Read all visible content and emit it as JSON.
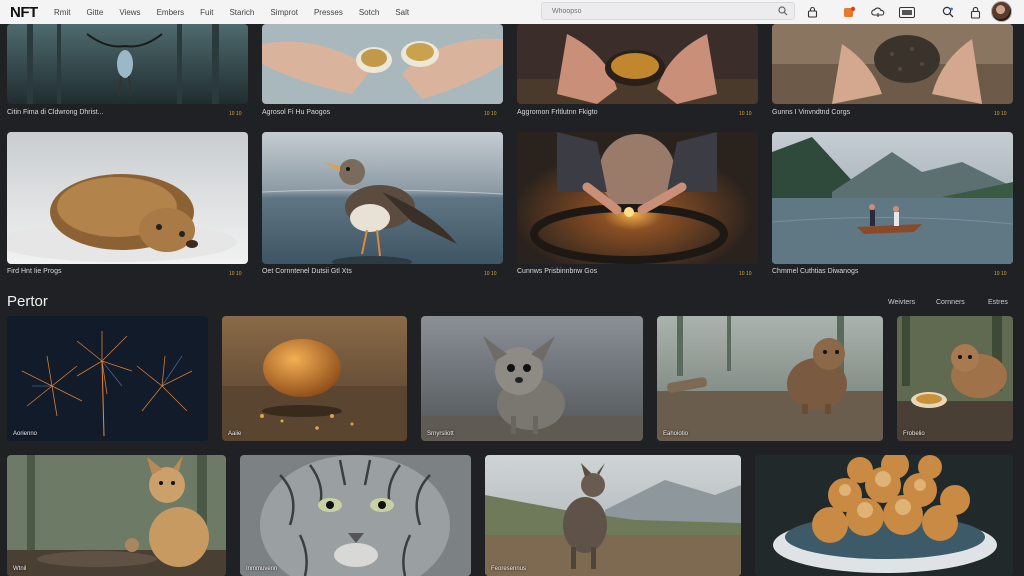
{
  "header": {
    "logo": "NFT",
    "nav": [
      "Rmit",
      "Gitte",
      "Views",
      "Embers",
      "Fuit",
      "Starich",
      "Simprot",
      "Presses",
      "Sotch",
      "Salt"
    ],
    "search_placeholder": "Whoopso"
  },
  "top_row": [
    {
      "caption": "Citin Fima di Cldwrong Dhrist...",
      "num": "10 10"
    },
    {
      "caption": "Agrosol Fi Hu Paogos",
      "num": "10 10"
    },
    {
      "caption": "Aggromon Frltlutnn Fkigto",
      "num": "10 10"
    },
    {
      "caption": "Gunns I Vinvndtnd Corgs",
      "num": "10 10"
    }
  ],
  "second_row": [
    {
      "caption": "Fird Hnt Iie Progs",
      "num": "10 10"
    },
    {
      "caption": "Oet Cornntenel Dutsii Gtl Xts",
      "num": "10 10"
    },
    {
      "caption": "Cunnws Prisbinnbnw Gos",
      "num": "10 10"
    },
    {
      "caption": "Chmmel Cuthtias Diwanogs",
      "num": "10 10"
    }
  ],
  "section": {
    "title": "Pertor",
    "links": [
      "Weivters",
      "Cornners",
      "Estres"
    ]
  },
  "third_row": [
    {
      "label": "Aorienno"
    },
    {
      "label": "Aaiie"
    },
    {
      "label": "Srnyrsliott"
    },
    {
      "label": "Eahoiotio"
    },
    {
      "label": "Frobelio"
    }
  ],
  "fourth_row": [
    {
      "label": "Wtnil"
    },
    {
      "label": "Inmmuvenn"
    },
    {
      "label": "Feoresennus"
    },
    {
      "label": ""
    }
  ]
}
